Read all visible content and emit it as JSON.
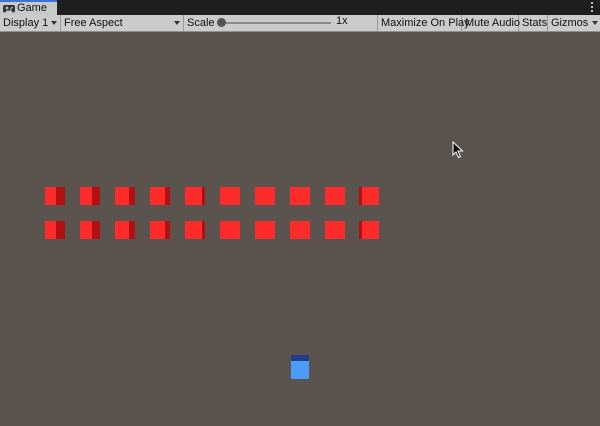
{
  "tab": {
    "label": "Game",
    "icon": "gamepad-icon"
  },
  "toolbar": {
    "display": "Display 1",
    "aspect": "Free Aspect",
    "scale_label": "Scale",
    "scale_value": "1x",
    "maximize": "Maximize On Play",
    "mute": "Mute Audio",
    "stats": "Stats",
    "gizmos": "Gizmos"
  },
  "scene": {
    "background": "#5b534e",
    "brick_color": "#fe2b2b",
    "brick_shade": "#b31111",
    "brick_rows": 2,
    "brick_columns": 10,
    "paddle_color": "#4b9cf6",
    "paddle_top_color": "#223c8e"
  }
}
